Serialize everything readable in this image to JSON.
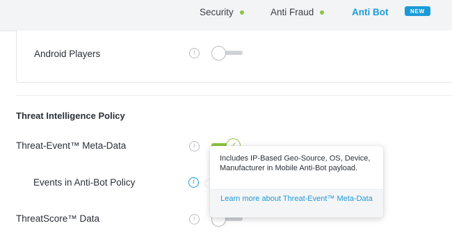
{
  "tabs": [
    {
      "label": "Security",
      "status_dot": true
    },
    {
      "label": "Anti Fraud",
      "status_dot": true
    },
    {
      "label": "Anti Bot",
      "status_dot": false,
      "active": true
    }
  ],
  "badge": "NEW",
  "colors": {
    "accent": "#1a9bd7",
    "enabled": "#8cc43f"
  },
  "card": {
    "setting_label": "Android Players",
    "toggle_on": false
  },
  "section": {
    "title": "Threat Intelligence Policy",
    "rows": [
      {
        "label": "Threat-Event™ Meta-Data",
        "toggle_on": true
      },
      {
        "label": "Events in Anti-Bot Policy",
        "toggle_on": false
      },
      {
        "label": "ThreatScore™ Data",
        "toggle_on": false
      }
    ]
  },
  "tooltip": {
    "body": "Includes IP-Based Geo-Source, OS, Device, Manufacturer in Mobile Anti-Bot payload.",
    "link": "Learn more about Threat-Event™ Meta-Data"
  },
  "icons": {
    "info": "info-icon",
    "check": "check-icon"
  }
}
